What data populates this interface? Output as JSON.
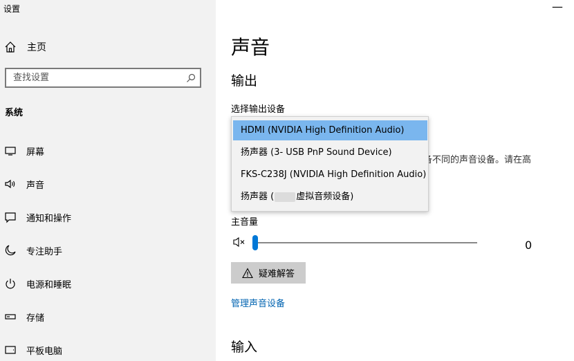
{
  "app": {
    "title": "设置",
    "close_label": "—"
  },
  "sidebar": {
    "home_label": "主页",
    "search_placeholder": "查找设置",
    "section_label": "系统",
    "items": [
      {
        "label": "屏幕",
        "icon": "monitor-icon"
      },
      {
        "label": "声音",
        "icon": "speaker-icon"
      },
      {
        "label": "通知和操作",
        "icon": "notification-icon"
      },
      {
        "label": "专注助手",
        "icon": "moon-icon"
      },
      {
        "label": "电源和睡眠",
        "icon": "power-icon"
      },
      {
        "label": "存储",
        "icon": "storage-icon"
      },
      {
        "label": "平板电脑",
        "icon": "tablet-icon"
      }
    ]
  },
  "main": {
    "title": "声音",
    "output_heading": "输出",
    "select_output_label": "选择输出设备",
    "hidden_desc_line1": "备不同的声音设备。请在高",
    "dropdown": {
      "options": [
        {
          "label": "HDMI (NVIDIA High Definition Audio)",
          "selected": true
        },
        {
          "label": "扬声器 (3- USB PnP Sound Device)",
          "selected": false
        },
        {
          "label": "FKS-C238J (NVIDIA High Definition Audio)",
          "selected": false
        },
        {
          "label_prefix": "扬声器 (",
          "label_suffix": "虚拟音频设备)",
          "selected": false
        }
      ]
    },
    "master_volume_label": "主音量",
    "volume_value": "0",
    "volume_level": 0,
    "troubleshoot_label": "疑难解答",
    "manage_devices_link": "管理声音设备",
    "input_heading": "输入"
  },
  "colors": {
    "accent": "#0078d7",
    "selected_option": "#7ab6ee",
    "link": "#0063b1",
    "sidebar_bg": "#f2f2f2"
  }
}
